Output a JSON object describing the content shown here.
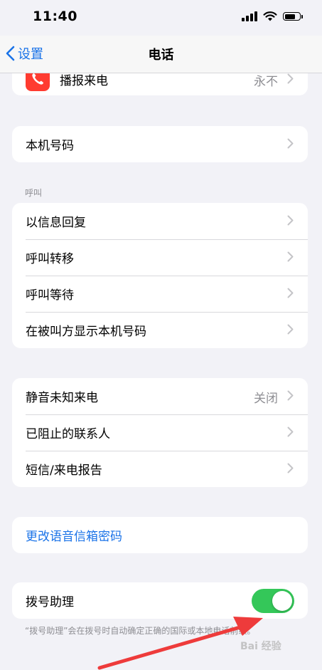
{
  "status_bar": {
    "time": "11:40"
  },
  "nav": {
    "back_label": "设置",
    "title": "电话"
  },
  "announce_calls": {
    "label": "播报来电",
    "value": "永不"
  },
  "my_number": {
    "label": "本机号码"
  },
  "calls_section": {
    "header": "呼叫",
    "items": [
      {
        "label": "以信息回复"
      },
      {
        "label": "呼叫转移"
      },
      {
        "label": "呼叫等待"
      },
      {
        "label": "在被叫方显示本机号码"
      }
    ]
  },
  "blocking_section": {
    "items": [
      {
        "label": "静音未知来电",
        "value": "关闭"
      },
      {
        "label": "已阻止的联系人",
        "value": ""
      },
      {
        "label": "短信/来电报告",
        "value": ""
      }
    ]
  },
  "voicemail": {
    "label": "更改语音信箱密码"
  },
  "dial_assist": {
    "label": "拨号助理",
    "enabled": true,
    "note": "“拨号助理”会在拨号时自动确定正确的国际或本地电话前缀。"
  },
  "watermark": "Bai 经验",
  "colors": {
    "accent": "#1a73e8",
    "toggle_on": "#34c759",
    "app_icon": "#ff3b30",
    "arrow": "#ee3b3b"
  }
}
